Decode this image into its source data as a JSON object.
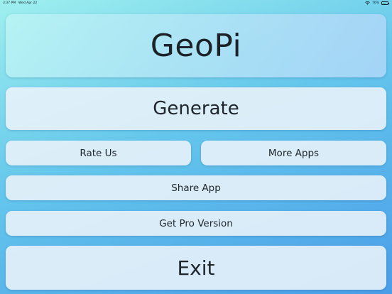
{
  "status_bar": {
    "time": "3:37 PM",
    "date": "Wed Apr 22",
    "battery_text": "76%",
    "battery_level": 0.76
  },
  "app": {
    "title": "GeoPi"
  },
  "menu": {
    "generate_label": "Generate",
    "rate_label": "Rate Us",
    "more_apps_label": "More Apps",
    "share_label": "Share App",
    "pro_label": "Get Pro Version",
    "exit_label": "Exit"
  },
  "colors": {
    "background_top": "#9ff0ee",
    "background_bottom": "#4a9de8",
    "card": "#e8f2fa",
    "text": "#1e252b",
    "battery_fill": "#30c750"
  }
}
